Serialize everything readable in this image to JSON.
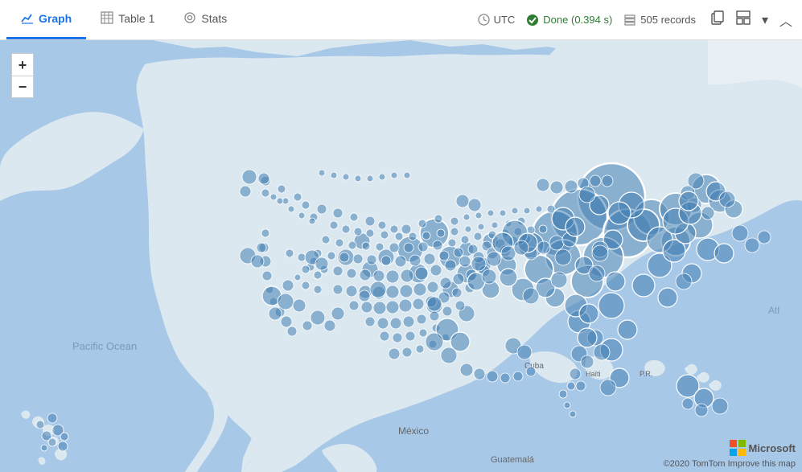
{
  "header": {
    "tabs": [
      {
        "id": "graph",
        "label": "Graph",
        "icon": "📈",
        "active": true
      },
      {
        "id": "table",
        "label": "Table 1",
        "icon": "⊞",
        "active": false
      },
      {
        "id": "stats",
        "label": "Stats",
        "icon": "◎",
        "active": false
      }
    ],
    "utc_label": "UTC",
    "done_label": "Done (0.394 s)",
    "records_label": "505 records"
  },
  "map": {
    "zoom_in": "+",
    "zoom_out": "−",
    "ocean_label": "Pacific Ocean",
    "atlantic_label": "Atl",
    "mexico_label": "México",
    "cuba_label": "Cuba",
    "haiti_label": "Haïti",
    "pr_label": "P.R.",
    "guatemala_label": "Guatemalá",
    "credit": "©2020 TomTom  Improve this map",
    "microsoft_text": "Microsoft"
  }
}
